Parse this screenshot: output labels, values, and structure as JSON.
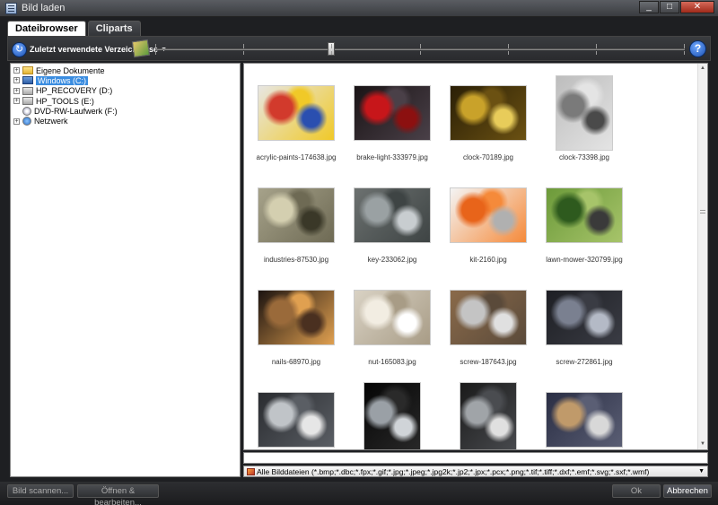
{
  "window": {
    "title": "Bild laden",
    "min": "_",
    "max": "□",
    "close": "✕"
  },
  "tabs": [
    {
      "label": "Dateibrowser",
      "active": true
    },
    {
      "label": "Cliparts",
      "active": false
    }
  ],
  "toolbar": {
    "recent_label": "Zuletzt verwendete Verzeichnisse",
    "help_label": "?"
  },
  "tree": [
    {
      "label": "Eigene Dokumente",
      "icon": "folder",
      "expandable": true,
      "selected": false
    },
    {
      "label": "Windows  (C:)",
      "icon": "win",
      "expandable": true,
      "selected": true
    },
    {
      "label": "HP_RECOVERY (D:)",
      "icon": "drive",
      "expandable": true,
      "selected": false
    },
    {
      "label": "HP_TOOLS (E:)",
      "icon": "drive",
      "expandable": true,
      "selected": false
    },
    {
      "label": "DVD-RW-Laufwerk (F:)",
      "icon": "dvd",
      "expandable": false,
      "selected": false
    },
    {
      "label": "Netzwerk",
      "icon": "net",
      "expandable": true,
      "selected": false
    }
  ],
  "files": [
    {
      "name": "acrylic-paints-174638.jpg",
      "colors": [
        "#e7e6e2",
        "#d23a2c",
        "#f0c928",
        "#2a4fb0"
      ],
      "orient": "land"
    },
    {
      "name": "brake-light-333979.jpg",
      "colors": [
        "#1a1416",
        "#c7161a",
        "#4a4048",
        "#8c1010"
      ],
      "orient": "land"
    },
    {
      "name": "clock-70189.jpg",
      "colors": [
        "#2a1f06",
        "#c9a22a",
        "#6b5112",
        "#e8cc5a"
      ],
      "orient": "land"
    },
    {
      "name": "clock-73398.jpg",
      "colors": [
        "#bdbdbd",
        "#7a7a7a",
        "#e4e4e4",
        "#4a4a4a"
      ],
      "orient": "port"
    },
    {
      "name": "industries-87530.jpg",
      "colors": [
        "#a6a28a",
        "#d4cfb0",
        "#6e6a54",
        "#3a3828"
      ],
      "orient": "land"
    },
    {
      "name": "key-233062.jpg",
      "colors": [
        "#6c7170",
        "#9aa1a3",
        "#3e4444",
        "#c8cdd0"
      ],
      "orient": "land"
    },
    {
      "name": "kit-2160.jpg",
      "colors": [
        "#f4f4f4",
        "#e8641a",
        "#f58a3a",
        "#b0b0b0"
      ],
      "orient": "land"
    },
    {
      "name": "lawn-mower-320799.jpg",
      "colors": [
        "#6c9a3a",
        "#2e5a1e",
        "#a7c46a",
        "#3a3a3a"
      ],
      "orient": "land"
    },
    {
      "name": "nails-68970.jpg",
      "colors": [
        "#1c1310",
        "#9a6a3a",
        "#e0a050",
        "#4a3020"
      ],
      "orient": "land"
    },
    {
      "name": "nut-165083.jpg",
      "colors": [
        "#d9d2c4",
        "#f2ede2",
        "#a89c86",
        "#ffffff"
      ],
      "orient": "land"
    },
    {
      "name": "screw-187643.jpg",
      "colors": [
        "#8a6a4a",
        "#c4c4c4",
        "#5a4a3a",
        "#e0e0e0"
      ],
      "orient": "land"
    },
    {
      "name": "screw-272861.jpg",
      "colors": [
        "#1e1f24",
        "#7a8090",
        "#3a3c44",
        "#b4bac6"
      ],
      "orient": "land"
    },
    {
      "name": "",
      "colors": [
        "#2a2c30",
        "#c0c4c8",
        "#5a5e64",
        "#e6e6e6"
      ],
      "orient": "land"
    },
    {
      "name": "",
      "colors": [
        "#050505",
        "#9aa0a6",
        "#2a2a2a",
        "#d0d4d8"
      ],
      "orient": "port"
    },
    {
      "name": "",
      "colors": [
        "#1a1a1a",
        "#a0a4a8",
        "#4a4c50",
        "#e0e0e0"
      ],
      "orient": "port"
    },
    {
      "name": "",
      "colors": [
        "#2a2e44",
        "#c09a6a",
        "#5a5e74",
        "#d8d8d8"
      ],
      "orient": "land"
    }
  ],
  "filter": {
    "label": "Alle Bilddateien (*.bmp;*.dbc;*.fpx;*.gif;*.jpg;*.jpeg;*.jpg2k;*.jp2;*.jpx;*.pcx;*.png;*.tif;*.tiff;*.dxf;*.emf;*.svg;*.sxf;*.wmf)"
  },
  "buttons": {
    "scan": "Bild scannen...",
    "open_edit": "Öffnen & bearbeiten...",
    "ok": "Ok",
    "cancel": "Abbrechen"
  },
  "zoom_level": 0.33
}
